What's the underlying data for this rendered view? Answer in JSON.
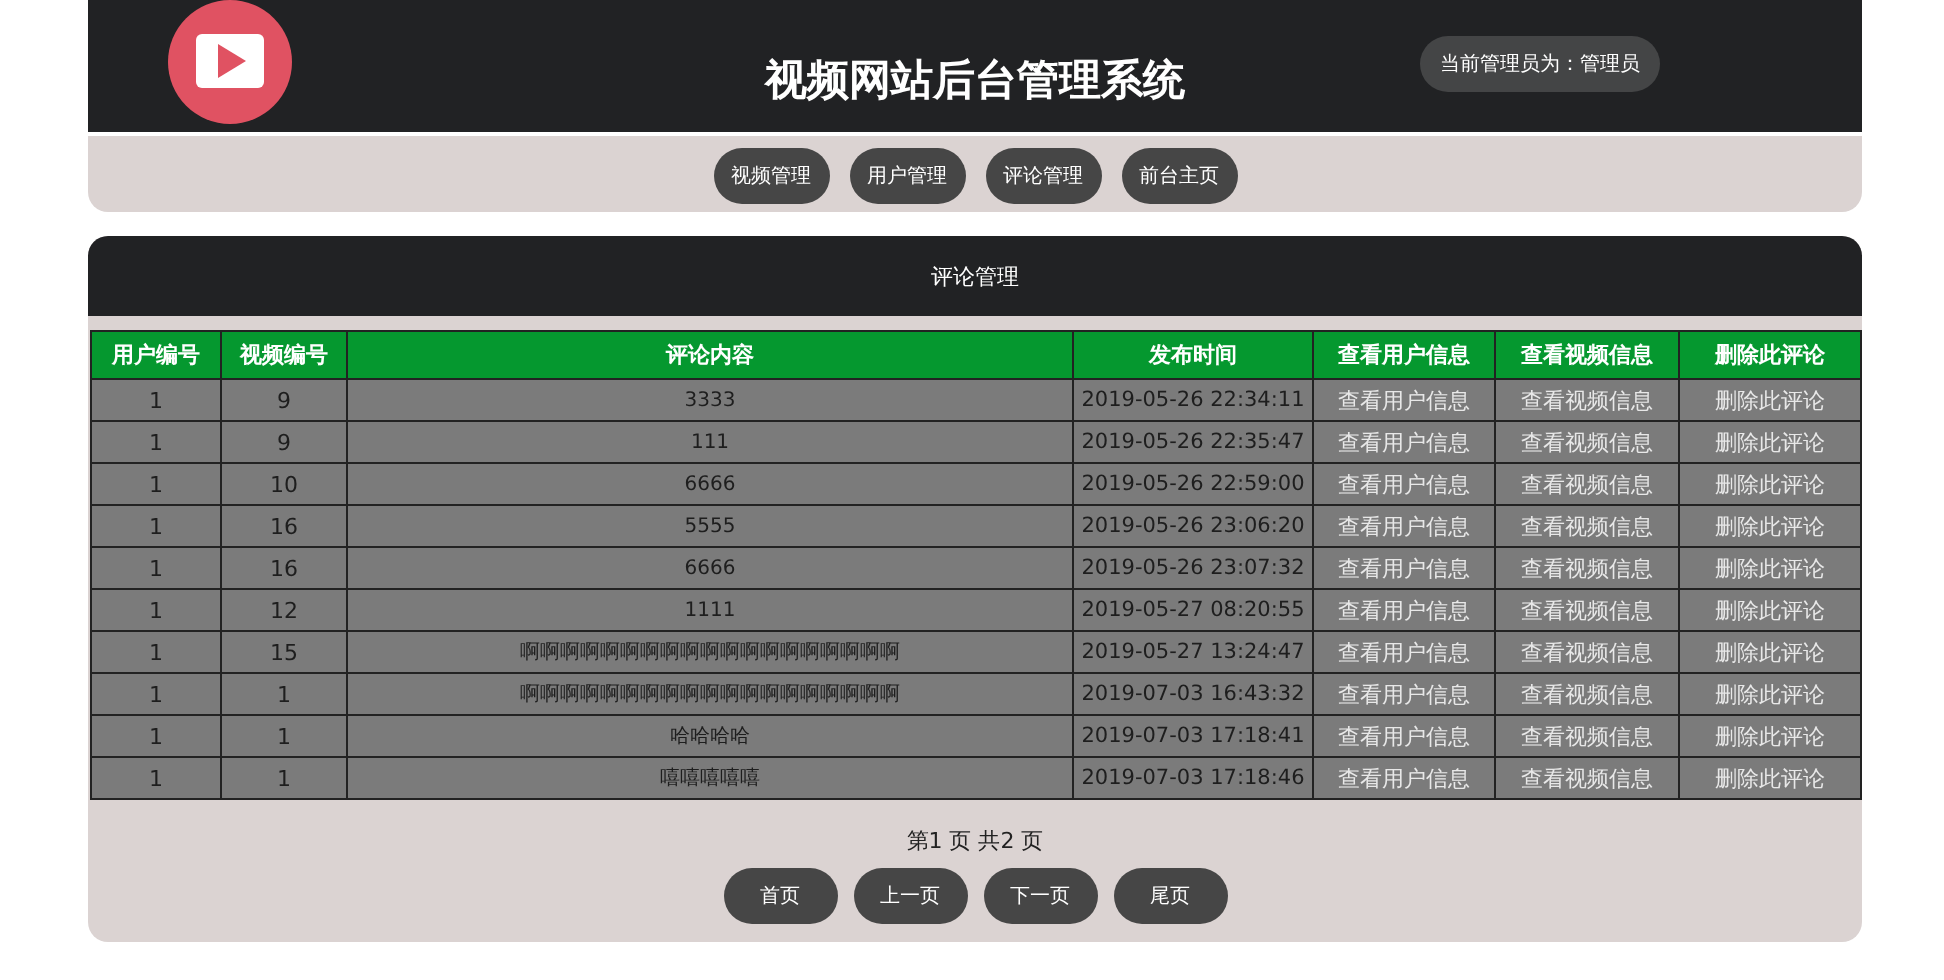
{
  "header": {
    "title": "视频网站后台管理系统",
    "admin": "当前管理员为：管理员"
  },
  "nav": [
    "视频管理",
    "用户管理",
    "评论管理",
    "前台主页"
  ],
  "panel": {
    "title": "评论管理"
  },
  "table": {
    "columns": [
      "用户编号",
      "视频编号",
      "评论内容",
      "发布时间",
      "查看用户信息",
      "查看视频信息",
      "删除此评论"
    ],
    "rows": [
      {
        "user_id": "1",
        "video_id": "9",
        "content": "3333",
        "time": "2019-05-26 22:34:11",
        "view_user": "查看用户信息",
        "view_video": "查看视频信息",
        "delete": "删除此评论"
      },
      {
        "user_id": "1",
        "video_id": "9",
        "content": "111",
        "time": "2019-05-26 22:35:47",
        "view_user": "查看用户信息",
        "view_video": "查看视频信息",
        "delete": "删除此评论"
      },
      {
        "user_id": "1",
        "video_id": "10",
        "content": "6666",
        "time": "2019-05-26 22:59:00",
        "view_user": "查看用户信息",
        "view_video": "查看视频信息",
        "delete": "删除此评论"
      },
      {
        "user_id": "1",
        "video_id": "16",
        "content": "5555",
        "time": "2019-05-26 23:06:20",
        "view_user": "查看用户信息",
        "view_video": "查看视频信息",
        "delete": "删除此评论"
      },
      {
        "user_id": "1",
        "video_id": "16",
        "content": "6666",
        "time": "2019-05-26 23:07:32",
        "view_user": "查看用户信息",
        "view_video": "查看视频信息",
        "delete": "删除此评论"
      },
      {
        "user_id": "1",
        "video_id": "12",
        "content": "1111",
        "time": "2019-05-27 08:20:55",
        "view_user": "查看用户信息",
        "view_video": "查看视频信息",
        "delete": "删除此评论"
      },
      {
        "user_id": "1",
        "video_id": "15",
        "content": "啊啊啊啊啊啊啊啊啊啊啊啊啊啊啊啊啊啊啊",
        "time": "2019-05-27 13:24:47",
        "view_user": "查看用户信息",
        "view_video": "查看视频信息",
        "delete": "删除此评论"
      },
      {
        "user_id": "1",
        "video_id": "1",
        "content": "啊啊啊啊啊啊啊啊啊啊啊啊啊啊啊啊啊啊啊",
        "time": "2019-07-03 16:43:32",
        "view_user": "查看用户信息",
        "view_video": "查看视频信息",
        "delete": "删除此评论"
      },
      {
        "user_id": "1",
        "video_id": "1",
        "content": "哈哈哈哈",
        "time": "2019-07-03 17:18:41",
        "view_user": "查看用户信息",
        "view_video": "查看视频信息",
        "delete": "删除此评论"
      },
      {
        "user_id": "1",
        "video_id": "1",
        "content": "嘻嘻嘻嘻嘻",
        "time": "2019-07-03 17:18:46",
        "view_user": "查看用户信息",
        "view_video": "查看视频信息",
        "delete": "删除此评论"
      }
    ]
  },
  "pagination": {
    "info": "第1 页  共2 页",
    "buttons": [
      "首页",
      "上一页",
      "下一页",
      "尾页"
    ]
  }
}
